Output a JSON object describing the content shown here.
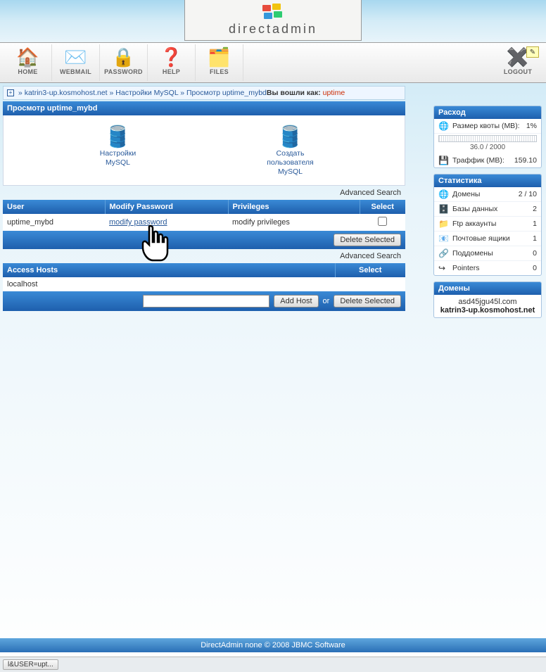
{
  "brand": {
    "name": "directadmin"
  },
  "toolbar": {
    "home": "HOME",
    "webmail": "WEBMAIL",
    "password": "PASSWORD",
    "help": "HELP",
    "files": "FILES",
    "logout": "LOGOUT"
  },
  "breadcrumb": {
    "sep": "»",
    "domain": "katrin3-up.kosmohost.net",
    "l2": "Настройки MySQL",
    "l3": "Просмотр uptime_mybd",
    "login_as_label": "Вы вошли как:",
    "user": "uptime"
  },
  "page_title": "Просмотр uptime_mybd",
  "quick_icons": {
    "settings": "Настройки\nMySQL",
    "create_user": "Создать\nпользователя\nMySQL"
  },
  "adv_search": "Advanced Search",
  "users_table": {
    "headers": {
      "user": "User",
      "modify_pw": "Modify Password",
      "privileges": "Privileges",
      "select": "Select"
    },
    "rows": [
      {
        "user": "uptime_mybd",
        "modify_pw": "modify password",
        "privileges": "modify privileges"
      }
    ],
    "delete_selected": "Delete Selected"
  },
  "hosts_table": {
    "headers": {
      "hosts": "Access Hosts",
      "select": "Select"
    },
    "rows": [
      {
        "host": "localhost"
      }
    ],
    "add_host": "Add Host",
    "or": "or",
    "delete_selected": "Delete Selected"
  },
  "side": {
    "usage": {
      "title": "Расход",
      "quota_label": "Размер квоты (МВ):",
      "quota_pct": "1%",
      "quota_used_total": "36.0 / 2000",
      "traffic_label": "Траффик (МВ):",
      "traffic_value": "159.10"
    },
    "stats": {
      "title": "Статистика",
      "rows": [
        {
          "icon": "🌐",
          "label": "Домены",
          "value": "2 / 10"
        },
        {
          "icon": "🗄️",
          "label": "Базы данных",
          "value": "2"
        },
        {
          "icon": "📁",
          "label": "Ftp аккаунты",
          "value": "1"
        },
        {
          "icon": "📧",
          "label": "Почтовые ящики",
          "value": "1"
        },
        {
          "icon": "🔗",
          "label": "Поддомены",
          "value": "0"
        },
        {
          "icon": "↪",
          "label": "Pointers",
          "value": "0"
        }
      ]
    },
    "domains": {
      "title": "Домены",
      "list": [
        "asd45jgu45l.com",
        "katrin3-up.kosmohost.net"
      ]
    }
  },
  "footer": "DirectAdmin none © 2008 JBMC Software",
  "statusbar": "l&USER=upt..."
}
